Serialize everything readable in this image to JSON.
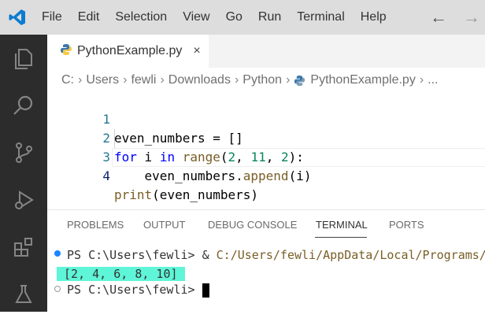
{
  "menu": [
    "File",
    "Edit",
    "Selection",
    "View",
    "Go",
    "Run",
    "Terminal",
    "Help"
  ],
  "nav": {
    "back": "←",
    "forward": "→"
  },
  "activity_bar": [
    "explorer-icon",
    "search-icon",
    "source-control-icon",
    "run-debug-icon",
    "extensions-icon",
    "testing-icon"
  ],
  "tab": {
    "label": "PythonExample.py",
    "close": "×"
  },
  "breadcrumb": [
    "C:",
    "Users",
    "fewli",
    "Downloads",
    "Python",
    "PythonExample.py",
    "..."
  ],
  "editor": {
    "line_numbers": [
      "1",
      "2",
      "3",
      "4"
    ],
    "lines": {
      "l1": {
        "var": "even_numbers",
        "rest": " = []"
      },
      "l2": {
        "kw1": "for",
        "sp1": " i ",
        "kw2": "in",
        "sp2": " ",
        "fn": "range",
        "p1": "(",
        "n1": "2",
        "c1": ", ",
        "n2": "11",
        "c2": ", ",
        "n3": "2",
        "p2": "):"
      },
      "l3": {
        "indent": "    ",
        "var": "even_numbers.",
        "fn": "append",
        "rest": "(i)"
      },
      "l4": {
        "fn": "print",
        "rest": "(even_numbers)"
      }
    }
  },
  "panel": {
    "tabs": [
      "PROBLEMS",
      "OUTPUT",
      "DEBUG CONSOLE",
      "TERMINAL",
      "PORTS"
    ],
    "active_tab": "TERMINAL"
  },
  "terminal": {
    "prompt": "PS C:\\Users\\fewli>",
    "command_amp": " & ",
    "command_path": "C:/Users/fewli/AppData/Local/Programs/",
    "output": " [2, 4, 6, 8, 10] ",
    "prompt2": "PS C:\\Users\\fewli> "
  },
  "colors": {
    "accent": "#007acc",
    "activity_bar_bg": "#2c2c2c",
    "title_bg": "#dddddd",
    "output_highlight": "#5ff5d8"
  }
}
